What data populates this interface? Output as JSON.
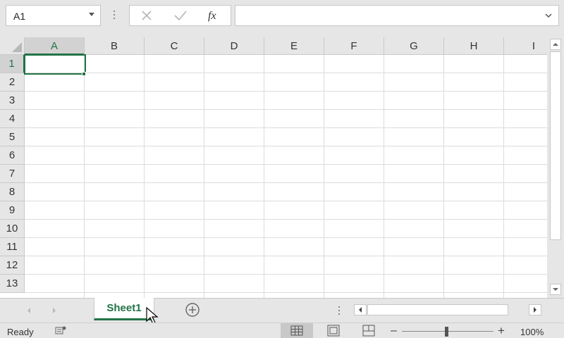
{
  "formula_bar": {
    "name_box": "A1",
    "cancel_icon": "close-icon",
    "enter_icon": "check-icon",
    "function_label": "fx",
    "formula_value": ""
  },
  "columns": [
    "A",
    "B",
    "C",
    "D",
    "E",
    "F",
    "G",
    "H",
    "I"
  ],
  "rows": [
    "1",
    "2",
    "3",
    "4",
    "5",
    "6",
    "7",
    "8",
    "9",
    "10",
    "11",
    "12",
    "13"
  ],
  "selected_cell": "A1",
  "sheets": [
    {
      "name": "Sheet1",
      "active": true
    }
  ],
  "status": {
    "text": "Ready",
    "zoom": "100%",
    "active_view": "normal"
  },
  "colors": {
    "accent": "#217346",
    "background": "#e6e6e6",
    "gridline": "#dcdcdc"
  }
}
